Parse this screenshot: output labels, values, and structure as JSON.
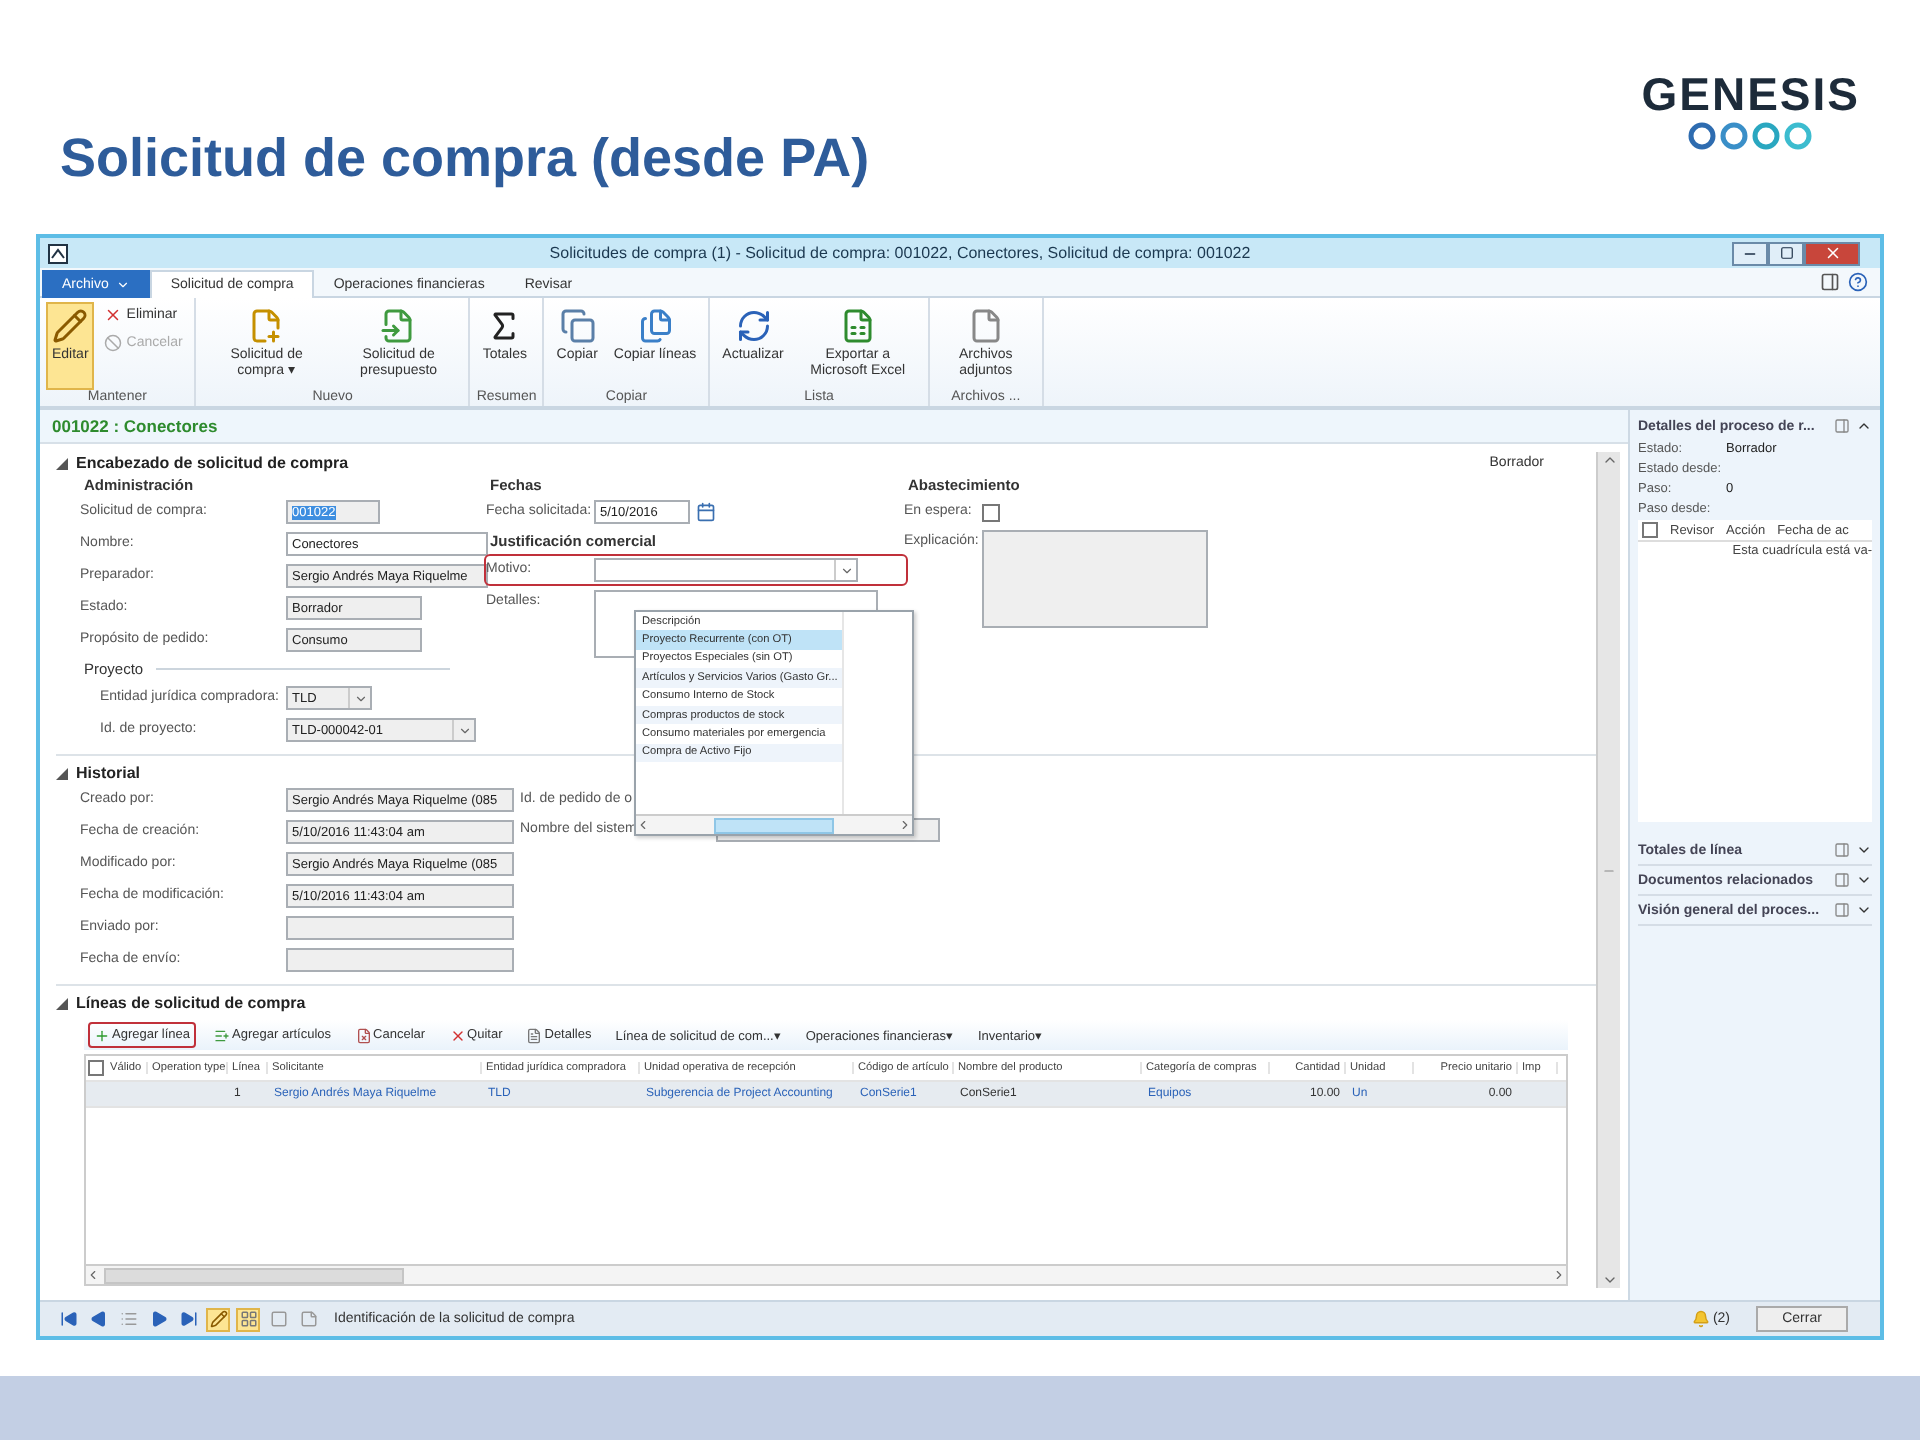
{
  "slide": {
    "title": "Solicitud de compra (desde PA)",
    "logo": "GENESIS"
  },
  "window": {
    "title": "Solicitudes de compra (1) - Solicitud de compra: 001022, Conectores, Solicitud de compra: 001022"
  },
  "tabs": [
    {
      "label": "Archivo",
      "kind": "menu",
      "selected": false
    },
    {
      "label": "Solicitud de compra",
      "kind": "tab",
      "selected": true
    },
    {
      "label": "Operaciones financieras",
      "kind": "tab",
      "selected": false
    },
    {
      "label": "Revisar",
      "kind": "tab",
      "selected": false
    }
  ],
  "ribbon": [
    {
      "label": "Mantener",
      "buttons": [
        {
          "label": "Editar",
          "kind": "large",
          "selected": true,
          "disabled": false
        },
        {
          "label": "Eliminar",
          "kind": "small",
          "selected": false,
          "disabled": false
        },
        {
          "label": "Cancelar",
          "kind": "small",
          "selected": false,
          "disabled": true
        }
      ]
    },
    {
      "label": "Nuevo",
      "buttons": [
        {
          "label": "Solicitud de compra ▾",
          "kind": "large",
          "selected": false,
          "disabled": false
        },
        {
          "label": "Solicitud de presupuesto",
          "kind": "large",
          "selected": false,
          "disabled": false
        }
      ]
    },
    {
      "label": "Resumen",
      "buttons": [
        {
          "label": "Totales",
          "kind": "large",
          "selected": false,
          "disabled": false
        }
      ]
    },
    {
      "label": "Copiar",
      "buttons": [
        {
          "label": "Copiar",
          "kind": "large",
          "selected": false,
          "disabled": false
        },
        {
          "label": "Copiar líneas",
          "kind": "large",
          "selected": false,
          "disabled": false
        }
      ]
    },
    {
      "label": "Lista",
      "buttons": [
        {
          "label": "Actualizar",
          "kind": "large",
          "selected": false,
          "disabled": false
        },
        {
          "label": "Exportar a Microsoft Excel",
          "kind": "large",
          "selected": false,
          "disabled": false
        }
      ]
    },
    {
      "label": "Archivos ...",
      "buttons": [
        {
          "label": "Archivos adjuntos",
          "kind": "large",
          "selected": false,
          "disabled": false
        }
      ]
    }
  ],
  "form_title": "001022 : Conectores",
  "header": {
    "title": "Encabezado de solicitud de compra",
    "expanded": true,
    "status": "Borrador",
    "columns": [
      {
        "heading": "Administración",
        "fields": [
          {
            "label": "Solicitud de compra:",
            "value": "001022",
            "kind": "text",
            "readonly": true,
            "value_selected": true
          },
          {
            "label": "Nombre:",
            "value": "Conectores",
            "kind": "text",
            "readonly": false
          },
          {
            "label": "Preparador:",
            "value": "Sergio Andrés Maya Riquelme",
            "kind": "text",
            "readonly": true
          },
          {
            "label": "Estado:",
            "value": "Borrador",
            "kind": "text",
            "readonly": true
          },
          {
            "label": "Propósito de pedido:",
            "value": "Consumo",
            "kind": "text",
            "readonly": true
          }
        ],
        "subgroup": {
          "heading": "Proyecto",
          "kind": "rule",
          "fields": [
            {
              "label": "Entidad jurídica compradora:",
              "value": "TLD",
              "kind": "combo",
              "readonly": true
            },
            {
              "label": "Id. de proyecto:",
              "value": "TLD-000042-01",
              "kind": "combo",
              "readonly": true
            }
          ]
        }
      },
      {
        "heading": "Fechas",
        "fields": [
          {
            "label": "Fecha solicitada:",
            "value": "5/10/2016",
            "kind": "date",
            "readonly": false
          }
        ],
        "subgroup": {
          "heading": "Justificación comercial",
          "kind": "bold",
          "fields": [
            {
              "label": "Motivo:",
              "kind": "combo",
              "readonly": false,
              "annotated": true
            },
            {
              "label": "Detalles:",
              "kind": "memo",
              "readonly": false
            }
          ]
        }
      },
      {
        "heading": "Abastecimiento",
        "fields": [
          {
            "label": "En espera:",
            "kind": "check",
            "checked": false
          },
          {
            "label": "Explicación:",
            "kind": "memo",
            "readonly": true
          }
        ]
      }
    ]
  },
  "motivo_dropdown": {
    "column_header": "Descripción",
    "items": [
      {
        "label": "Proyecto Recurrente (con OT)",
        "selected": true
      },
      {
        "label": "Proyectos Especiales (sin OT)",
        "selected": false
      },
      {
        "label": "Artículos y Servicios Varios (Gasto Gr...",
        "selected": false
      },
      {
        "label": "Consumo Interno de Stock",
        "selected": false
      },
      {
        "label": "Compras productos de stock",
        "selected": false
      },
      {
        "label": "Consumo materiales por emergencia",
        "selected": false
      },
      {
        "label": "Compra de Activo Fijo",
        "selected": false
      }
    ]
  },
  "history": {
    "title": "Historial",
    "expanded": true,
    "columns": [
      {
        "fields": [
          {
            "label": "Creado por:",
            "value": "Sergio Andrés Maya Riquelme (085",
            "kind": "text",
            "readonly": true
          },
          {
            "label": "Fecha de creación:",
            "value": "5/10/2016 11:43:04 am",
            "kind": "text",
            "readonly": true
          },
          {
            "label": "Modificado por:",
            "value": "Sergio Andrés Maya Riquelme (085",
            "kind": "text",
            "readonly": true
          },
          {
            "label": "Fecha de modificación:",
            "value": "5/10/2016 11:43:04 am",
            "kind": "text",
            "readonly": true
          },
          {
            "label": "Enviado por:",
            "kind": "text",
            "readonly": true
          },
          {
            "label": "Fecha de envío:",
            "kind": "text",
            "readonly": true
          }
        ]
      },
      {
        "fields": [
          {
            "label": "Id. de pedido de o",
            "kind": "covered"
          },
          {
            "label": "Nombre del sistem",
            "kind": "text",
            "readonly": true
          }
        ]
      }
    ]
  },
  "lines": {
    "title": "Líneas de solicitud de compra",
    "expanded": true,
    "toolbar": [
      {
        "label": "Agregar línea",
        "annotated": true
      },
      {
        "label": "Agregar artículos",
        "annotated": false
      },
      {
        "label": "Cancelar",
        "annotated": false
      },
      {
        "label": "Quitar",
        "annotated": false
      },
      {
        "label": "Detalles",
        "annotated": false
      },
      {
        "label": "Línea de solicitud de com...▾",
        "annotated": false
      },
      {
        "label": "Operaciones financieras▾",
        "annotated": false
      },
      {
        "label": "Inventario▾",
        "annotated": false
      }
    ],
    "select_all_checked": false,
    "columns": [
      "Válido",
      "Operation type",
      "Línea",
      "Solicitante",
      "Entidad jurídica compradora",
      "Unidad operativa de recepción",
      "Código de artículo",
      "Nombre del producto",
      "Categoría de compras",
      "Cantidad",
      "Unidad",
      "Precio unitario",
      "Imp"
    ],
    "rows": [
      {
        "selected": true,
        "cells": [
          null,
          null,
          {
            "text": "1",
            "link": false
          },
          {
            "text": "Sergio Andrés Maya Riquelme",
            "link": true
          },
          {
            "text": "TLD",
            "link": true
          },
          {
            "text": "Subgerencia de Project Accounting",
            "link": true
          },
          {
            "text": "ConSerie1",
            "link": true
          },
          {
            "text": "ConSerie1",
            "link": false
          },
          {
            "text": "Equipos",
            "link": true
          },
          {
            "text": "10.00",
            "link": false
          },
          {
            "text": "Un",
            "link": true
          },
          {
            "text": "0.00",
            "link": false
          },
          null
        ]
      }
    ]
  },
  "side_panel": {
    "title": "Detalles del proceso de r...",
    "expanded": true,
    "fields": [
      {
        "label": "Estado:",
        "value": "Borrador"
      },
      {
        "label": "Estado desde:"
      },
      {
        "label": "Paso:",
        "value": "0"
      },
      {
        "label": "Paso desde:"
      }
    ],
    "grid": {
      "select_all_checked": false,
      "columns": [
        "Revisor",
        "Acción",
        "Fecha de ac"
      ],
      "empty_message": "Esta cuadrícula está va-"
    },
    "collapsed_panels": [
      {
        "title": "Totales de línea",
        "expanded": false
      },
      {
        "title": "Documentos relacionados",
        "expanded": false
      },
      {
        "title": "Visión general del proces...",
        "expanded": false
      }
    ]
  },
  "status_bar": {
    "text": "Identificación de la solicitud de compra",
    "notifications": "(2)",
    "close_button": "Cerrar"
  }
}
